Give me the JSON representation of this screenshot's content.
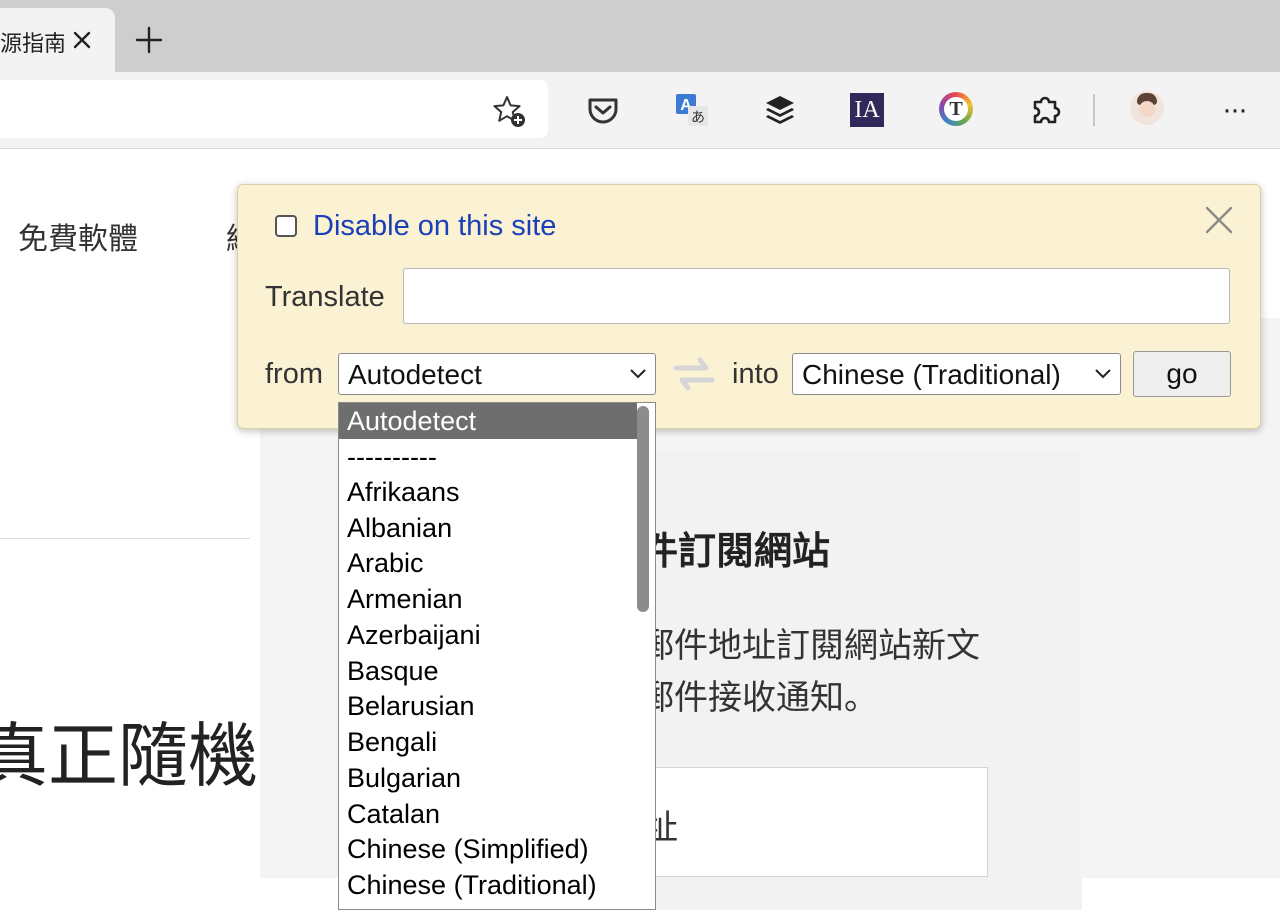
{
  "tab": {
    "title": "源指南"
  },
  "page": {
    "nav_item_1": "免費軟體",
    "nav_item_2": "網",
    "big_heading": "真正隨機",
    "widget_title": "件訂閱網站",
    "widget_desc_line1": "郵件地址訂閱網站新文",
    "widget_desc_line2": "郵件接收通知。",
    "email_placeholder": "址"
  },
  "toolbar": {
    "icons": [
      "star-add-icon",
      "pocket-icon",
      "translate-icon",
      "buffer-icon",
      "ia-icon",
      "t-circle-icon",
      "extensions-icon",
      "avatar",
      "more-icon"
    ],
    "ia_label": "IA",
    "t_label": "T",
    "more_label": "···"
  },
  "translate_popup": {
    "disable_label": "Disable on this site",
    "disable_checked": false,
    "translate_label": "Translate",
    "translate_value": "",
    "from_label": "from",
    "from_value": "Autodetect",
    "into_label": "into",
    "into_value": "Chinese (Traditional)",
    "go_label": "go",
    "colors": {
      "popup_bg": "#fbf2d4",
      "link": "#1a3fb8",
      "selected_option_bg": "#6e6e6e"
    }
  },
  "language_dropdown": {
    "selected": "Autodetect",
    "options": [
      "Autodetect",
      "----------",
      "Afrikaans",
      "Albanian",
      "Arabic",
      "Armenian",
      "Azerbaijani",
      "Basque",
      "Belarusian",
      "Bengali",
      "Bulgarian",
      "Catalan",
      "Chinese (Simplified)",
      "Chinese (Traditional)"
    ]
  }
}
